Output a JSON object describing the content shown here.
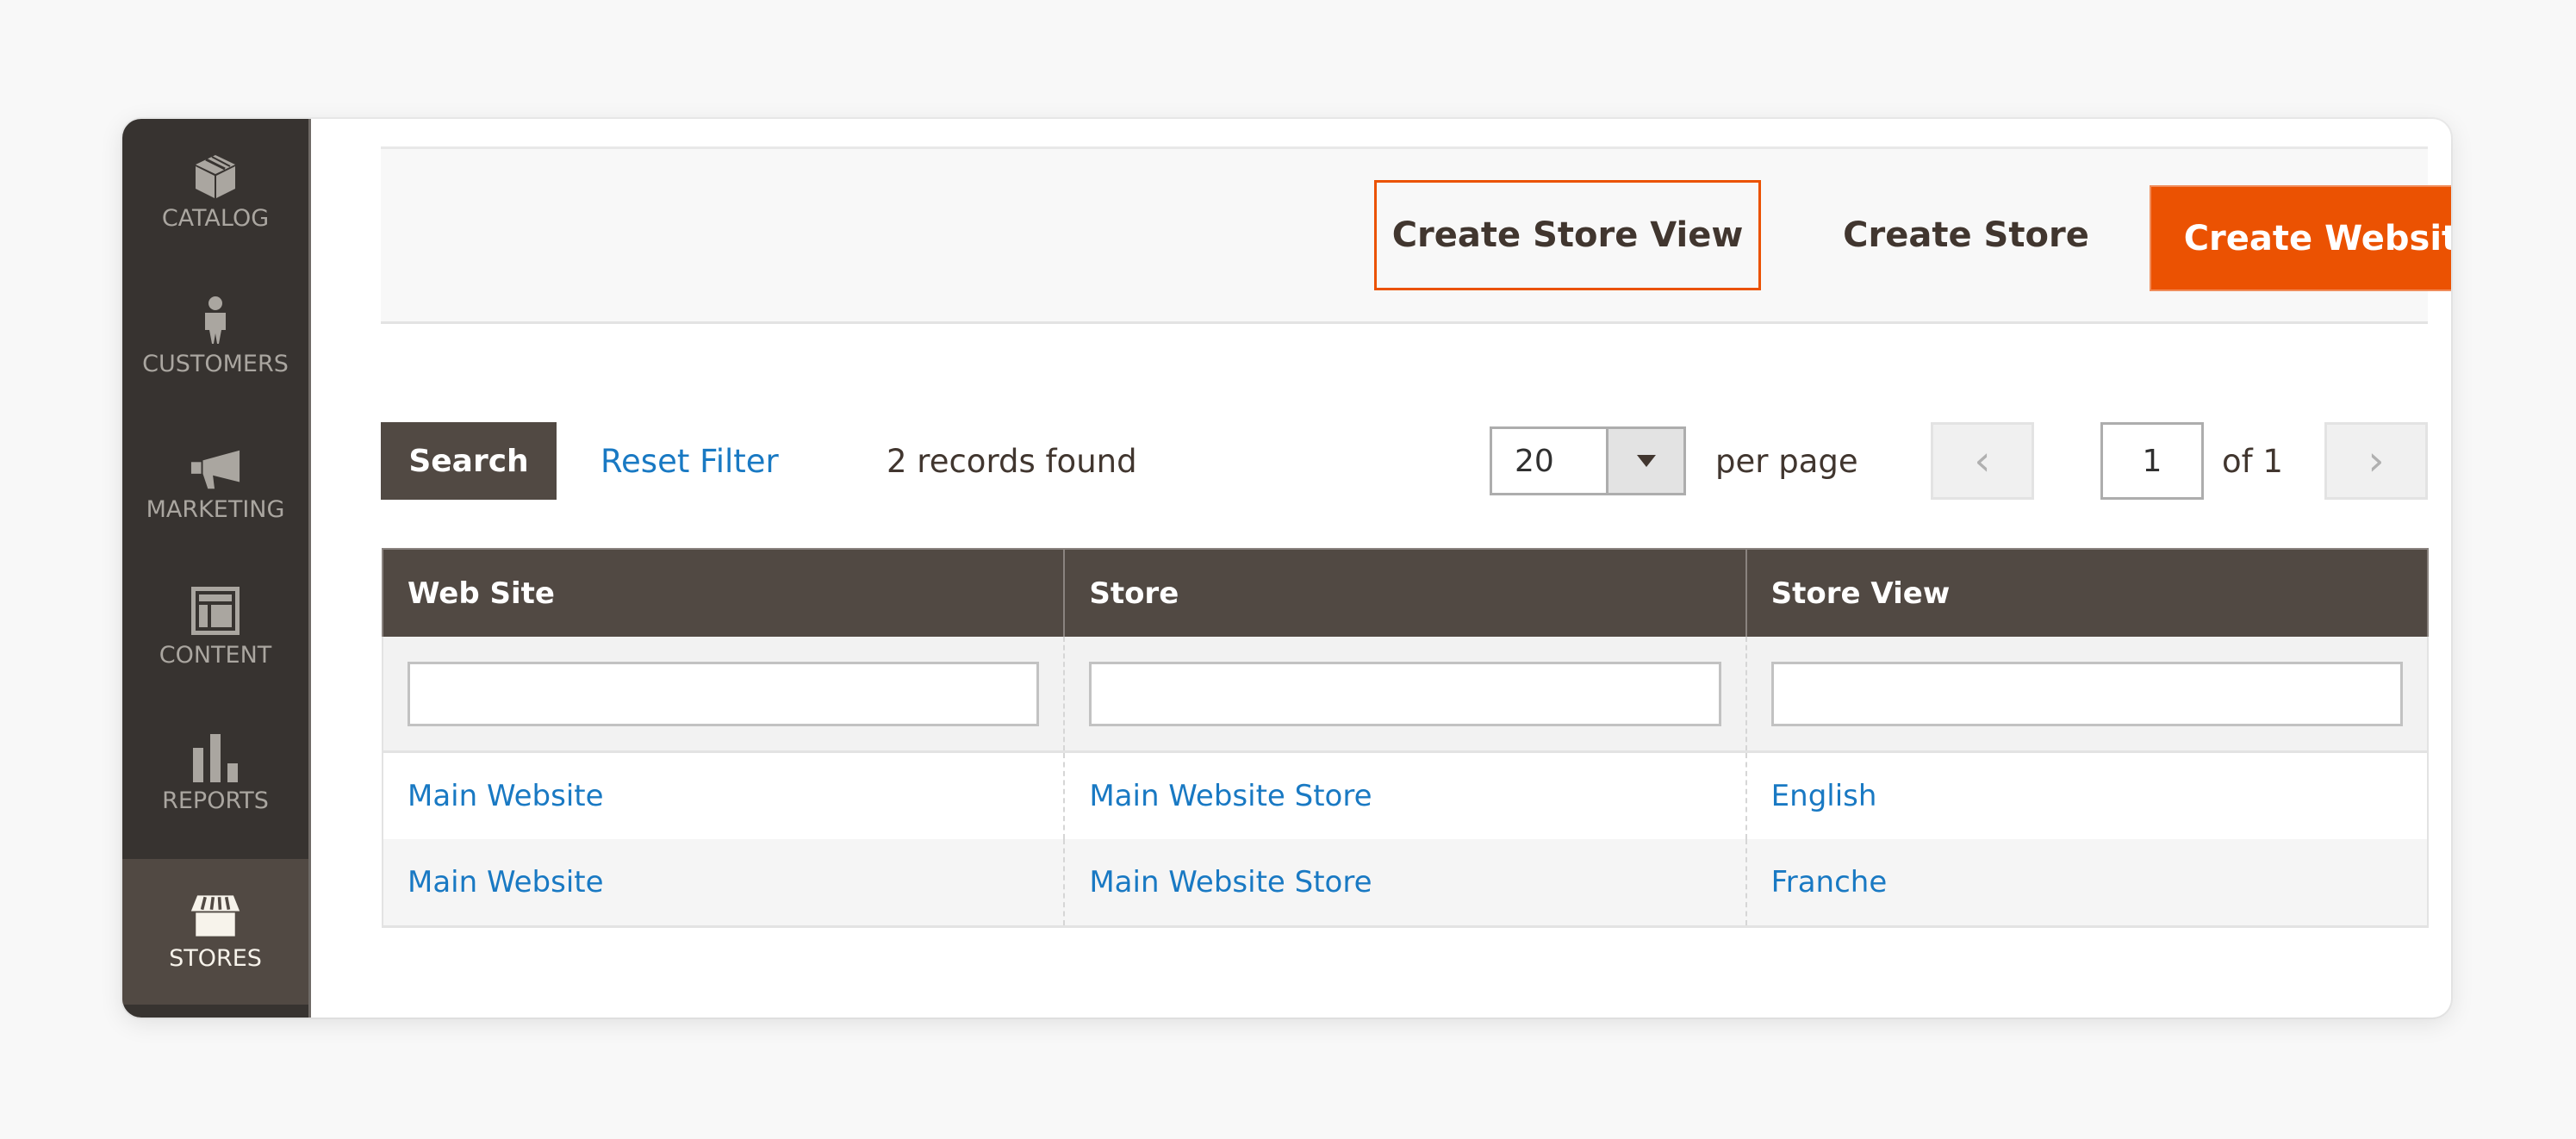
{
  "sidebar": {
    "items": [
      {
        "label": "CATALOG",
        "icon": "box-icon",
        "active": false
      },
      {
        "label": "CUSTOMERS",
        "icon": "person-icon",
        "active": false
      },
      {
        "label": "MARKETING",
        "icon": "megaphone-icon",
        "active": false
      },
      {
        "label": "CONTENT",
        "icon": "layout-icon",
        "active": false
      },
      {
        "label": "REPORTS",
        "icon": "bar-chart-icon",
        "active": false
      },
      {
        "label": "STORES",
        "icon": "storefront-icon",
        "active": true
      }
    ]
  },
  "actions": {
    "create_store_view": "Create Store View",
    "create_store": "Create Store",
    "create_website": "Create Website"
  },
  "toolbar": {
    "search_label": "Search",
    "reset_filter_label": "Reset Filter",
    "records_found": "2 records found",
    "per_page_value": "20",
    "per_page_label": "per page",
    "prev_icon": "‹",
    "next_icon": "›",
    "current_page": "1",
    "page_of": "of 1"
  },
  "colors": {
    "accent": "#eb5202",
    "header_bg": "#514943",
    "sidebar_bg": "#373330",
    "link": "#1979c3"
  },
  "table": {
    "columns": [
      "Web Site",
      "Store",
      "Store View"
    ],
    "filters": [
      "",
      "",
      ""
    ],
    "rows": [
      {
        "website": "Main Website",
        "store": "Main Website Store",
        "store_view": "English"
      },
      {
        "website": "Main Website",
        "store": "Main Website Store",
        "store_view": "Franche"
      }
    ]
  }
}
